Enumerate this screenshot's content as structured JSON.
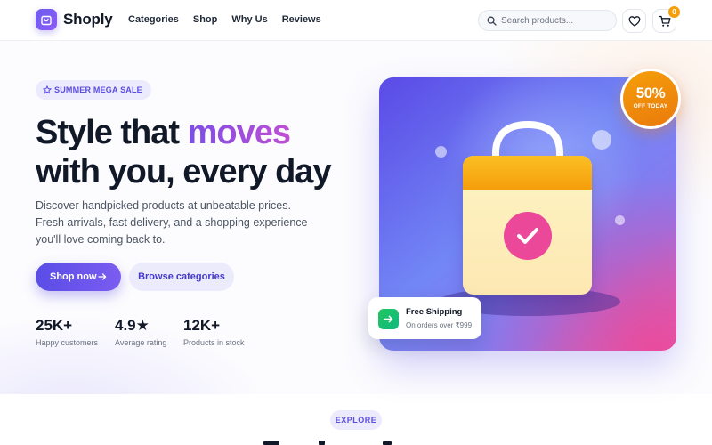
{
  "brand": {
    "name": "Shoply",
    "logo_icon": "shopping-bag-icon",
    "accent": "#6d5cf0"
  },
  "nav": {
    "links": [
      "Categories",
      "Shop",
      "Why Us",
      "Reviews"
    ]
  },
  "search": {
    "placeholder": "Search products...",
    "value": "",
    "icon": "search-icon"
  },
  "header_actions": {
    "wishlist_icon": "heart-icon",
    "cart_icon": "cart-icon",
    "cart_count": "0",
    "badge_color": "#f59e0b"
  },
  "hero": {
    "badge": "SUMMER MEGA SALE",
    "badge_icon": "star-icon",
    "headline_part1": "Style that ",
    "headline_accent": "moves",
    "headline_line2": "with you, every day",
    "description": "Discover handpicked products at unbeatable prices. Fresh arrivals, fast delivery, and a shopping experience you'll love coming back to.",
    "primary_cta": "Shop now",
    "secondary_cta": "Browse categories",
    "stats": [
      {
        "value": "25K+",
        "label": "Happy customers"
      },
      {
        "value": "4.9★",
        "label": "Average rating"
      },
      {
        "value": "12K+",
        "label": "Products in stock"
      }
    ]
  },
  "promo_card": {
    "discount": "50%",
    "discount_label": "OFF TODAY",
    "shipping_title": "Free Shipping",
    "shipping_subtitle": "On orders over ₹999",
    "shipping_icon": "arrow-right-icon",
    "check_icon": "check-icon",
    "colors": {
      "orange": "#f59e0b",
      "pink": "#ec4899",
      "green": "#22c55e",
      "purple": "#5a4ae6"
    }
  },
  "section": {
    "eyebrow": "EXPLORE"
  }
}
